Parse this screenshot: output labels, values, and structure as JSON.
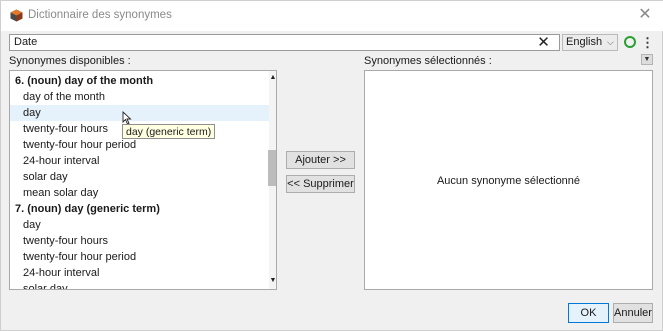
{
  "window": {
    "title": "Dictionnaire des synonymes",
    "close_glyph": "✕"
  },
  "search": {
    "value": "Date",
    "clear_glyph": "✕"
  },
  "language": {
    "selected": "English",
    "arrow_glyph": "⌵"
  },
  "toolbar": {
    "more_glyph": "⋮",
    "collapse_glyph": "▼"
  },
  "left_panel": {
    "label": "Synonymes disponibles :",
    "items": [
      {
        "text": "6. (noun) day of the month",
        "type": "h"
      },
      {
        "text": "day of the month",
        "type": "s"
      },
      {
        "text": "day",
        "type": "s",
        "selected": true
      },
      {
        "text": "twenty-four hours",
        "type": "s"
      },
      {
        "text": "twenty-four hour period",
        "type": "s"
      },
      {
        "text": "24-hour interval",
        "type": "s"
      },
      {
        "text": "solar day",
        "type": "s"
      },
      {
        "text": "mean solar day",
        "type": "s"
      },
      {
        "text": "7. (noun) day (generic term)",
        "type": "h"
      },
      {
        "text": "day",
        "type": "s"
      },
      {
        "text": "twenty-four hours",
        "type": "s"
      },
      {
        "text": "twenty-four hour period",
        "type": "s"
      },
      {
        "text": "24-hour interval",
        "type": "s"
      },
      {
        "text": "solar day",
        "type": "s"
      }
    ],
    "scroll_up_glyph": "▲",
    "scroll_down_glyph": "▼"
  },
  "tooltip": {
    "text": "day (generic term)"
  },
  "buttons": {
    "add": "Ajouter >>",
    "remove": "<< Supprimer",
    "ok": "OK",
    "cancel": "Annuler"
  },
  "right_panel": {
    "label": "Synonymes sélectionnés :",
    "empty_text": "Aucun synonyme sélectionné"
  },
  "colors": {
    "accent": "#0078d7",
    "valid": "#2aa033",
    "selection": "#e5f1fb"
  }
}
